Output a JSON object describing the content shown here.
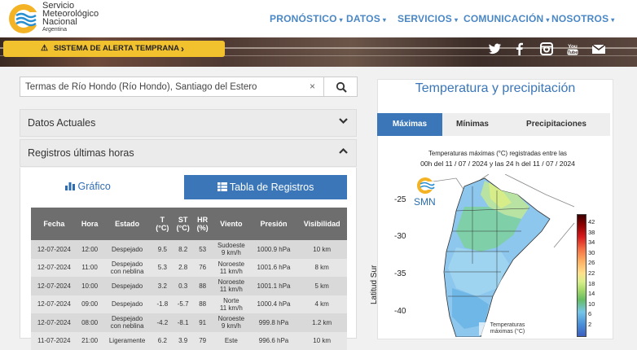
{
  "brand": {
    "line1": "Servicio",
    "line2": "Meteorológico",
    "line3": "Nacional",
    "line4": "Argentina"
  },
  "nav": [
    {
      "label": "PRONÓSTICO"
    },
    {
      "label": "DATOS"
    },
    {
      "label": "SERVICIOS"
    },
    {
      "label": "COMUNICACIÓN"
    },
    {
      "label": "NOSOTROS"
    }
  ],
  "alert_button": {
    "label": "SISTEMA DE ALERTA TEMPRANA"
  },
  "social": [
    "twitter-icon",
    "facebook-icon",
    "instagram-icon",
    "youtube-icon",
    "mail-icon"
  ],
  "search": {
    "value": "Termas de Río Hondo (Río Hondo), Santiago del Estero"
  },
  "panels": {
    "datos_actuales": "Datos Actuales",
    "registros": "Registros últimas horas"
  },
  "tabs": {
    "grafico": "Gráfico",
    "tabla": "Tabla de Registros"
  },
  "table": {
    "headers": [
      "Fecha",
      "Hora",
      "Estado",
      "T\n(°C)",
      "ST\n(°C)",
      "HR\n(%)",
      "Viento",
      "Presión",
      "Visibilidad"
    ],
    "rows": [
      [
        "12-07-2024",
        "12:00",
        "Despejado",
        "9.5",
        "8.2",
        "53",
        "Sudoeste\n9 km/h",
        "1000.9 hPa",
        "10 km"
      ],
      [
        "12-07-2024",
        "11:00",
        "Despejado\ncon neblina",
        "5.3",
        "2.8",
        "76",
        "Noroeste\n11 km/h",
        "1001.6 hPa",
        "8 km"
      ],
      [
        "12-07-2024",
        "10:00",
        "Despejado",
        "3.2",
        "0.3",
        "88",
        "Noroeste\n11 km/h",
        "1001.1 hPa",
        "5 km"
      ],
      [
        "12-07-2024",
        "09:00",
        "Despejado",
        "-1.8",
        "-5.7",
        "88",
        "Norte\n11 km/h",
        "1000.4 hPa",
        "4 km"
      ],
      [
        "12-07-2024",
        "08:00",
        "Despejado\ncon neblina",
        "-4.2",
        "-8.1",
        "91",
        "Noroeste\n9 km/h",
        "999.8 hPa",
        "1.2 km"
      ],
      [
        "11-07-2024",
        "21:00",
        "Ligeramente",
        "6.2",
        "3.9",
        "79",
        "Este",
        "996.6 hPa",
        "10 km"
      ]
    ]
  },
  "right": {
    "title": "Temperatura y precipitación",
    "tabs": [
      "Máximas",
      "Mínimas",
      "Precipitaciones"
    ],
    "caption_line1": "Temperaturas máximas (°C) registradas entre las",
    "caption_line2": "00h del 11 / 07 / 2024 y las 24 h del 11 / 07 / 2024",
    "map_logo": "SMN",
    "y_ticks": [
      "-25",
      "-30",
      "-35",
      "-40"
    ],
    "y_axis_title": "Latitud Sur",
    "colorbar_ticks": [
      "42",
      "38",
      "34",
      "30",
      "26",
      "22",
      "18",
      "14",
      "10",
      "6",
      "2"
    ],
    "legend_label": "Temperaturas máximas (°C)"
  },
  "colors": {
    "accent": "#3a76b8",
    "nav": "#4a87c5",
    "alert": "#f2c12e"
  }
}
